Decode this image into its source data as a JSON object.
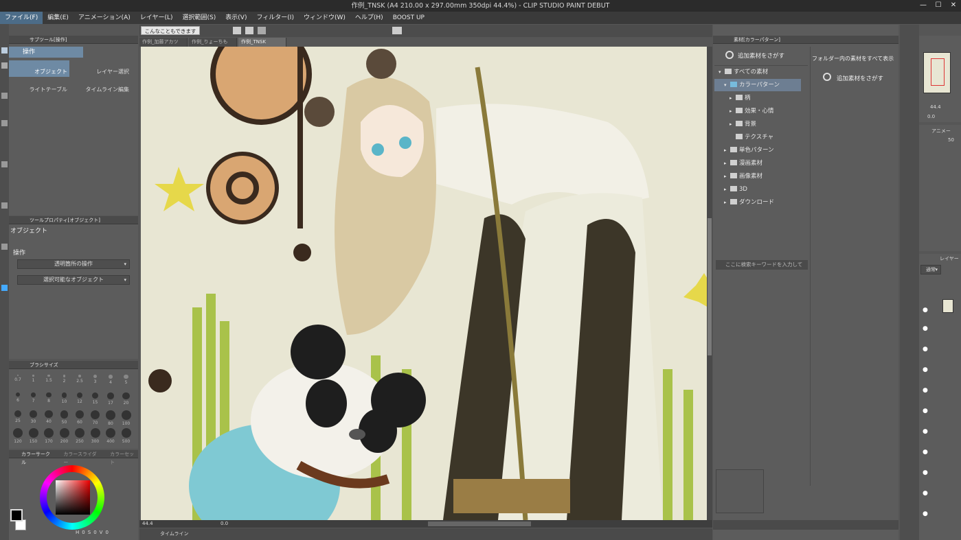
{
  "window": {
    "title": "作例_TNSK (A4 210.00 x 297.00mm 350dpi 44.4%) - CLIP STUDIO PAINT DEBUT",
    "controls": [
      "—",
      "☐",
      "✕"
    ]
  },
  "menu": [
    "ファイル(F)",
    "編集(E)",
    "アニメーション(A)",
    "レイヤー(L)",
    "選択範囲(S)",
    "表示(V)",
    "フィルター(I)",
    "ウィンドウ(W)",
    "ヘルプ(H)",
    "BOOST UP"
  ],
  "toolbar": {
    "hint_button": "こんなこともできます"
  },
  "tabs": [
    "作例_加藤アカツ",
    "作例_りょーちも",
    "作例_TNSK"
  ],
  "subtool": {
    "header": "サブツール[操作]",
    "group": "操作",
    "items": [
      "オブジェクト",
      "レイヤー選択",
      "ライトテーブル",
      "タイムライン編集"
    ]
  },
  "toolprop": {
    "header": "ツールプロパティ[オブジェクト]",
    "title": "オブジェクト",
    "section": "操作",
    "dropdowns": [
      "透明箇所の操作",
      "選択可能なオブジェクト"
    ]
  },
  "brushsize": {
    "header": "ブラシサイズ",
    "sizes": [
      "0.7",
      "1",
      "1.5",
      "2",
      "2.5",
      "3",
      "4",
      "5",
      "6",
      "7",
      "8",
      "10",
      "12",
      "15",
      "17",
      "20",
      "25",
      "30",
      "40",
      "50",
      "60",
      "70",
      "80",
      "100",
      "120",
      "150",
      "170",
      "200",
      "250",
      "300",
      "400",
      "500"
    ]
  },
  "color": {
    "tabs": [
      "カラーサークル",
      "カラースライダー",
      "カラーセット"
    ],
    "readout": [
      "H",
      "0",
      "S",
      "0",
      "V",
      "0"
    ],
    "main": "#000000",
    "sub": "#ffffff"
  },
  "status": {
    "zoom": "44.4",
    "angle": "0.0",
    "timeline": "タイムライン"
  },
  "material": {
    "header": "素材[カラーパターン]",
    "search_button": "追加素材をさがす",
    "show_all": "フォルダー内の素材をすべて表示",
    "search_button2": "追加素材をさがす",
    "search_placeholder": "ここに検索キーワードを入力して",
    "tree": [
      "すべての素材",
      "カラーパターン",
      "柄",
      "効果・心情",
      "背景",
      "テクスチャ",
      "単色パターン",
      "漫画素材",
      "画像素材",
      "3D",
      "ダウンロード"
    ]
  },
  "navigator": {
    "zoom": "44.4",
    "angle": "0.0",
    "anim": "アニメー",
    "opacity": "50"
  },
  "layer": {
    "header": "レイヤー",
    "blend": "通常"
  },
  "colors": {
    "accent": "#4c6c88",
    "panel": "#5c5c5c",
    "dark": "#3a3a3a",
    "canvas_bg": "#e6e4cf"
  }
}
